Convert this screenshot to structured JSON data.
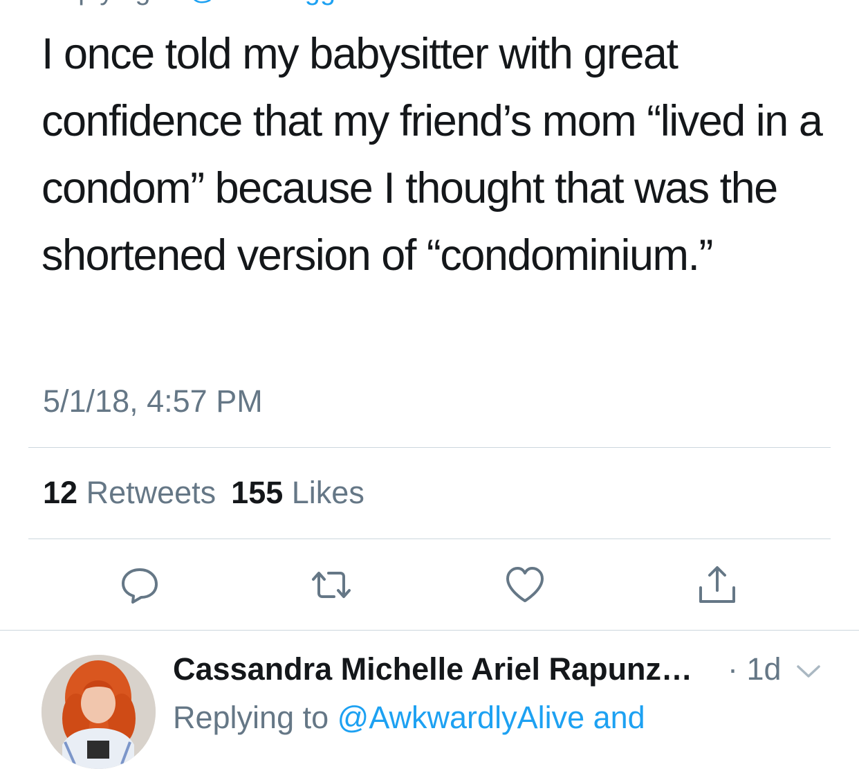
{
  "reply_context_top": {
    "prefix": "Replying to",
    "handle": "@TheBloggess"
  },
  "tweet": {
    "text": "I once told my babysitter with great confidence that my friend’s mom “lived in a condom” because I thought that was the shortened version of “condominium.”",
    "timestamp": "5/1/18, 4:57 PM",
    "retweets_count": "12",
    "retweets_label": "Retweets",
    "likes_count": "155",
    "likes_label": "Likes"
  },
  "actions": {
    "reply_icon": "reply-icon",
    "retweet_icon": "retweet-icon",
    "like_icon": "heart-icon",
    "share_icon": "share-icon"
  },
  "reply_tweet": {
    "author_name": "Cassandra Michelle Ariel Rapunz…",
    "time": "· 1d",
    "replying_prefix": "Replying to",
    "replying_handle": "@AwkwardlyAlive and"
  },
  "colors": {
    "text_primary": "#14171a",
    "text_secondary": "#657786",
    "link": "#1da1f2",
    "divider": "#ccd6dd"
  }
}
